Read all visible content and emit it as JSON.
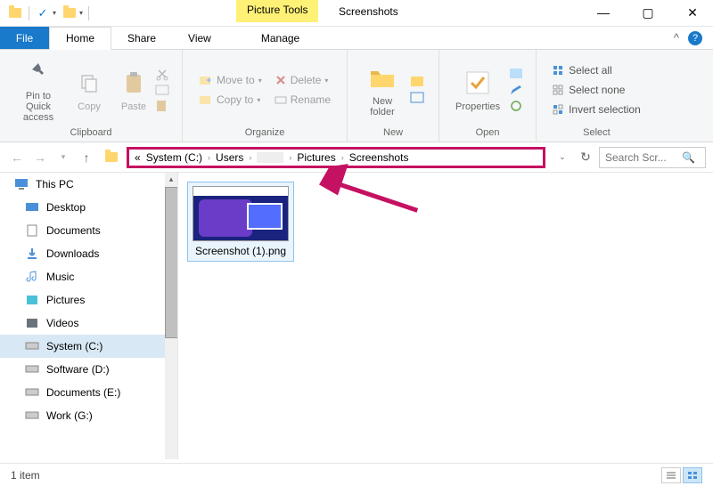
{
  "title_bar": {
    "context_tab": "Picture Tools",
    "window_title": "Screenshots"
  },
  "tabs": {
    "file": "File",
    "home": "Home",
    "share": "Share",
    "view": "View",
    "manage": "Manage"
  },
  "ribbon": {
    "clipboard": {
      "label": "Clipboard",
      "pin": "Pin to Quick\naccess",
      "copy": "Copy",
      "paste": "Paste"
    },
    "organize": {
      "label": "Organize",
      "move_to": "Move to",
      "copy_to": "Copy to",
      "delete": "Delete",
      "rename": "Rename"
    },
    "new": {
      "label": "New",
      "new_folder": "New\nfolder"
    },
    "open": {
      "label": "Open",
      "properties": "Properties"
    },
    "select": {
      "label": "Select",
      "select_all": "Select all",
      "select_none": "Select none",
      "invert": "Invert selection"
    }
  },
  "breadcrumb": {
    "prefix": "«",
    "items": [
      "System (C:)",
      "Users",
      "",
      "Pictures",
      "Screenshots"
    ]
  },
  "search_placeholder": "Search Scr...",
  "nav": {
    "this_pc": "This PC",
    "items": [
      "Desktop",
      "Documents",
      "Downloads",
      "Music",
      "Pictures",
      "Videos",
      "System (C:)",
      "Software (D:)",
      "Documents (E:)",
      "Work (G:)"
    ]
  },
  "file": {
    "name": "Screenshot (1).png"
  },
  "status": {
    "item_count": "1 item"
  }
}
